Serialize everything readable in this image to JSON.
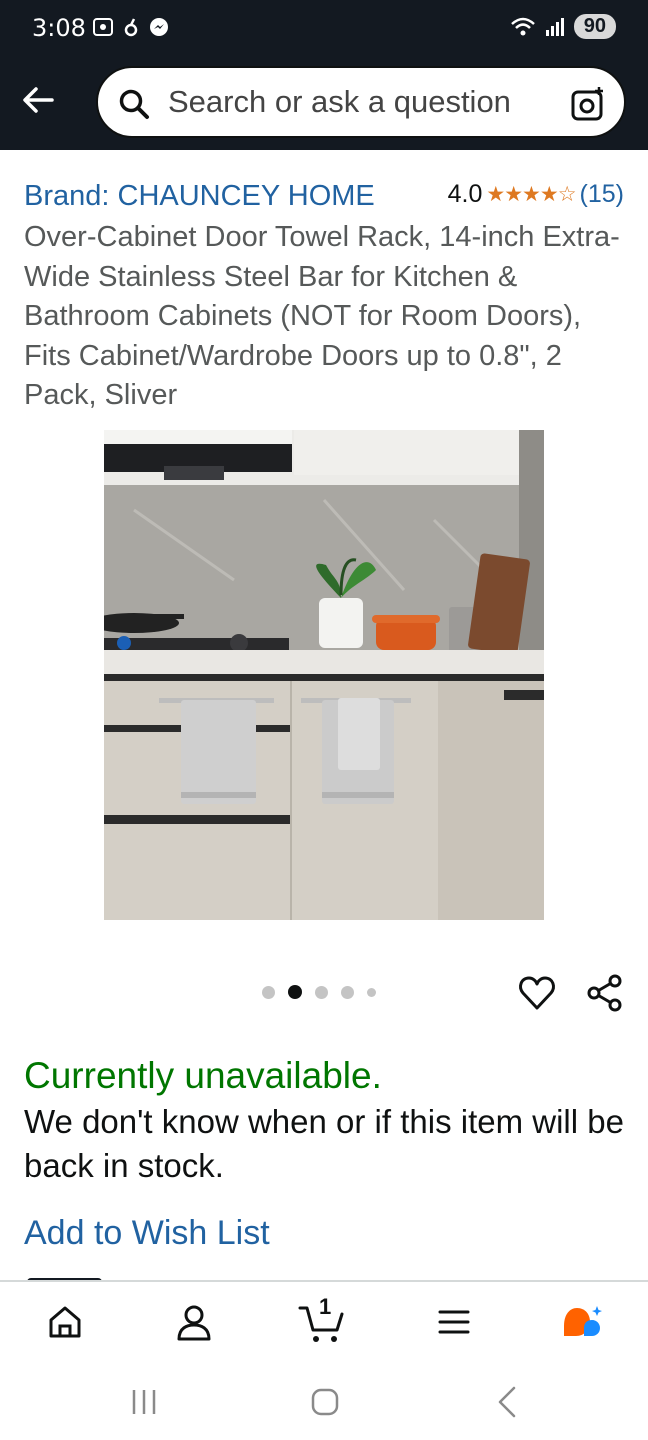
{
  "status_bar": {
    "time": "3:08",
    "battery": "90"
  },
  "search": {
    "placeholder": "Search or ask a question"
  },
  "product": {
    "brand": "Brand: CHAUNCEY HOME",
    "rating_value": "4.0",
    "rating_stars": 4,
    "rating_count": "(15)",
    "title": "Over-Cabinet Door Towel Rack, 14-inch Extra-Wide Stainless Steel Bar for Kitchen & Bathroom Cabinets (NOT for Room Doors), Fits Cabinet/Wardrobe Doors up to 0.8\", 2 Pack, Sliver"
  },
  "carousel": {
    "total_images": 5,
    "active_index": 1
  },
  "availability": {
    "status": "Currently unavailable.",
    "message": "We don't know when or if this item will be back in stock."
  },
  "actions": {
    "wishlist": "Add to Wish List"
  },
  "bottom_nav": {
    "items": [
      "home-icon",
      "account-icon",
      "cart-icon",
      "menu-icon",
      "rufus-icon"
    ],
    "cart_count": "1"
  },
  "colors": {
    "header_bg": "#131921",
    "link": "#2162a1",
    "available_green": "#007600",
    "star": "#de7921",
    "rufus_orange": "#ff6200",
    "rufus_blue": "#1a8cff"
  }
}
